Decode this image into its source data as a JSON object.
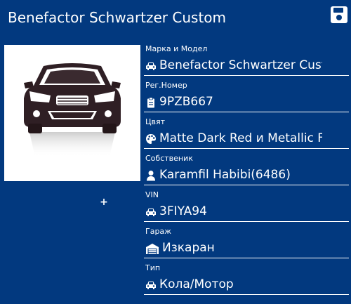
{
  "header": {
    "title": "Benefactor Schwartzer Custom",
    "save_icon": "floppy-disk-icon"
  },
  "photo": {
    "image_icon": "car-front-photo",
    "add_label": "+"
  },
  "colors": {
    "background": "#02397f",
    "text": "#ffffff"
  },
  "fields": [
    {
      "label": "Марка и Модел",
      "value": "Benefactor Schwartzer Cust",
      "icon": "car-icon"
    },
    {
      "label": "Рег.Номер",
      "value": "9PZB667",
      "icon": "clipboard-icon"
    },
    {
      "label": "Цвят",
      "value": "Matte Dark Red и Metallic F",
      "icon": "palette-icon"
    },
    {
      "label": "Собственик",
      "value": "Karamfil Habibi(6486)",
      "icon": "user-icon"
    },
    {
      "label": "VIN",
      "value": "3FIYA94",
      "icon": "car-icon"
    },
    {
      "label": "Гараж",
      "value": "Изкаран",
      "icon": "garage-icon"
    },
    {
      "label": "Тип",
      "value": "Кола/Мотор",
      "icon": "car-icon"
    }
  ]
}
